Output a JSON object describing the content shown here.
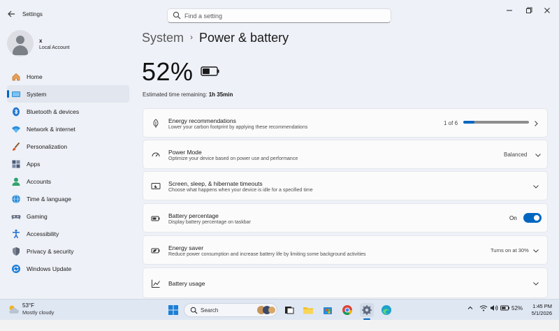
{
  "window": {
    "app_title": "Settings",
    "search_placeholder": "Find a setting"
  },
  "profile": {
    "name": "x",
    "account_type": "Local Account"
  },
  "sidebar": {
    "items": [
      {
        "label": "Home",
        "icon": "home-icon"
      },
      {
        "label": "System",
        "icon": "system-icon",
        "active": true
      },
      {
        "label": "Bluetooth & devices",
        "icon": "bluetooth-icon"
      },
      {
        "label": "Network & internet",
        "icon": "wifi-icon"
      },
      {
        "label": "Personalization",
        "icon": "brush-icon"
      },
      {
        "label": "Apps",
        "icon": "apps-icon"
      },
      {
        "label": "Accounts",
        "icon": "accounts-icon"
      },
      {
        "label": "Time & language",
        "icon": "globe-clock-icon"
      },
      {
        "label": "Gaming",
        "icon": "gaming-icon"
      },
      {
        "label": "Accessibility",
        "icon": "accessibility-icon"
      },
      {
        "label": "Privacy & security",
        "icon": "shield-icon"
      },
      {
        "label": "Windows Update",
        "icon": "update-icon"
      }
    ]
  },
  "header": {
    "breadcrumb_parent": "System",
    "breadcrumb_separator": "›",
    "page_title": "Power & battery"
  },
  "battery": {
    "percent": "52%",
    "level": 0.52,
    "estimate_label": "Estimated time remaining:",
    "estimate_value": "1h 35min"
  },
  "cards": {
    "energy_recommendations": {
      "title": "Energy recommendations",
      "description": "Lower your carbon footprint by applying these recommendations",
      "progress_text": "1 of 6",
      "progress": 0.167
    },
    "power_mode": {
      "title": "Power Mode",
      "description": "Optimize your device based on power use and performance",
      "value": "Balanced"
    },
    "screen_sleep": {
      "title": "Screen, sleep, & hibernate timeouts",
      "description": "Choose what happens when your device is idle for a specified time"
    },
    "battery_percentage": {
      "title": "Battery percentage",
      "description": "Display battery percentage on taskbar",
      "toggle_label": "On",
      "toggle_on": true
    },
    "energy_saver": {
      "title": "Energy saver",
      "description": "Reduce power consumption and increase battery life by limiting some background activities",
      "value": "Turns on at 30%"
    },
    "battery_usage": {
      "title": "Battery usage"
    }
  },
  "taskbar": {
    "weather_temp": "53°F",
    "weather_desc": "Mostly cloudy",
    "search_label": "Search",
    "battery_percent": "52%",
    "time": "1:45 PM",
    "date": "5/1/2026"
  },
  "colors": {
    "accent": "#0067c0",
    "background": "#eef1f7",
    "card": "#fbfbfc"
  }
}
